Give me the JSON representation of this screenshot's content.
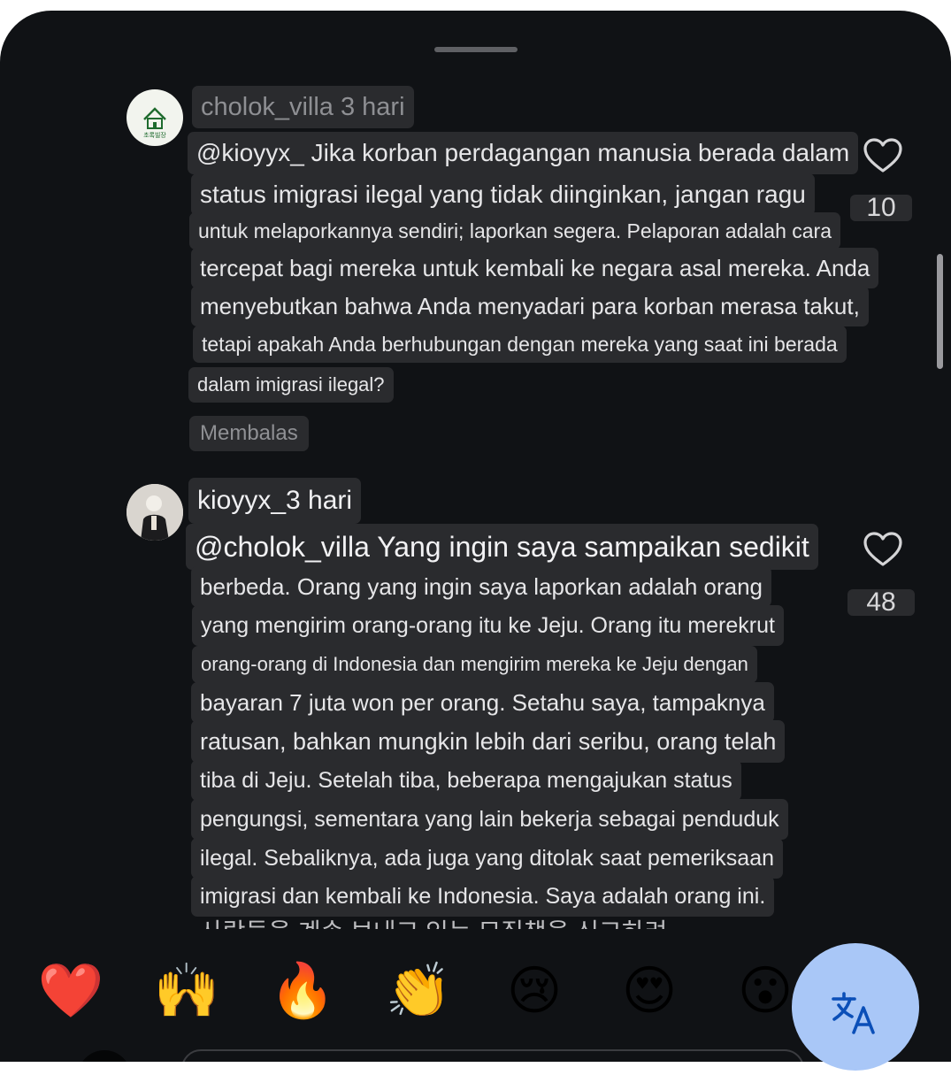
{
  "comments": [
    {
      "username": "cholok_villa",
      "time": "3 hari",
      "meta": "cholok_villa 3 hari",
      "avatar_label": "초록빌장",
      "lines": [
        "@kioyyx_ Jika korban perdagangan manusia berada dalam",
        "status imigrasi ilegal yang tidak diinginkan, jangan ragu",
        "untuk melaporkannya sendiri; laporkan segera. Pelaporan adalah cara",
        "tercepat bagi mereka untuk kembali ke negara asal mereka. Anda",
        "menyebutkan bahwa Anda menyadari para korban merasa takut,",
        "tetapi apakah Anda berhubungan dengan mereka yang saat ini berada",
        "dalam imigrasi ilegal?"
      ],
      "reply_label": "Membalas",
      "like_count": "10"
    },
    {
      "username": "kioyyx_",
      "time": "3 hari",
      "meta": "kioyyx_3 hari",
      "lines": [
        "@cholok_villa Yang ingin saya sampaikan sedikit",
        "berbeda. Orang yang ingin saya laporkan adalah orang",
        "yang mengirim orang-orang itu ke Jeju. Orang itu merekrut",
        "orang-orang di Indonesia dan mengirim mereka ke Jeju dengan",
        "bayaran 7 juta won per orang. Setahu saya, tampaknya",
        "ratusan, bahkan mungkin lebih dari seribu, orang telah",
        "tiba di Jeju. Setelah tiba, beberapa mengajukan status",
        "pengungsi, sementara yang lain bekerja sebagai penduduk",
        "ilegal. Sebaliknya, ada juga yang ditolak saat pemeriksaan",
        "imigrasi dan kembali ke Indonesia. Saya adalah orang ini."
      ],
      "cut_line": "사람들을 계속 보내고 있는 모집책을 신고하려",
      "like_count": "48"
    }
  ],
  "reactions": [
    "❤️",
    "🙌",
    "🔥",
    "👏",
    "😢",
    "😍",
    "😮"
  ],
  "reaction_names": [
    "heart",
    "raised-hands",
    "fire",
    "clapping-hands",
    "crying-face",
    "heart-eyes-face",
    "surprised-face"
  ],
  "translate_icon": "translate-icon",
  "colors": {
    "background": "#101215",
    "highlight": "#2a2b2e",
    "translate_fab": "#a9c7f7",
    "translate_icon": "#0b4fb8"
  }
}
